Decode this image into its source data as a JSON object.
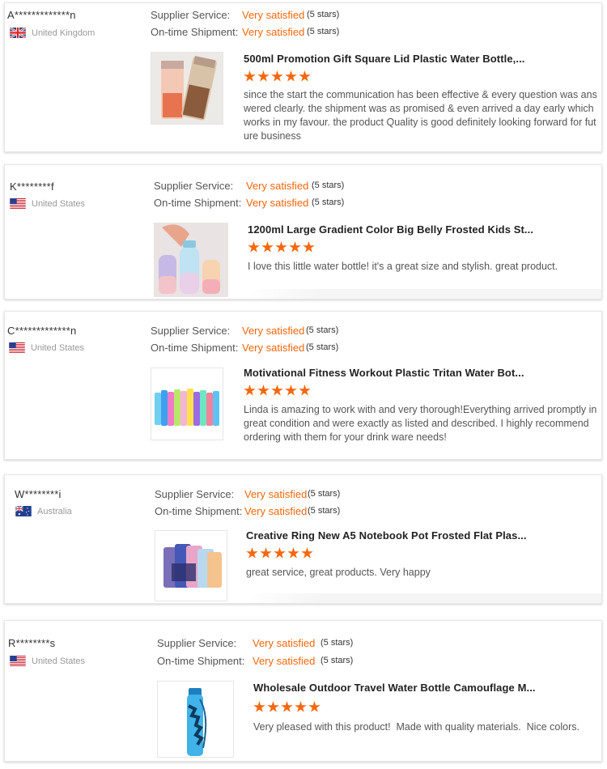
{
  "labels": {
    "supplier": "Supplier Service:",
    "shipment": "On-time Shipment:"
  },
  "reviews": [
    {
      "user": "A*************n",
      "country": "United Kingdom",
      "flag_icon": "uk-flag",
      "supplier_value": "Very satisfied",
      "supplier_stars": "(5 stars)",
      "shipment_value": "Very satisfied",
      "shipment_stars": "(5 stars)",
      "product_title": "500ml Promotion Gift Square Lid Plastic Water Bottle,...",
      "rating": 5,
      "text": "since the start the communication has been effective & every question was answered clearly. the shipment was as promised & even arrived a day early which works in my favour. the product Quality is good definitely looking forward for future business"
    },
    {
      "user": "K********f",
      "country": "United States",
      "flag_icon": "us-flag",
      "supplier_value": "Very satisfied",
      "supplier_stars": "(5 stars)",
      "shipment_value": "Very satisfied",
      "shipment_stars": "(5 stars)",
      "product_title": "1200ml Large Gradient Color Big Belly Frosted Kids St...",
      "rating": 5,
      "text": "I love this little water bottle! it's a great size and stylish. great product."
    },
    {
      "user": "C*************n",
      "country": "United States",
      "flag_icon": "us-flag",
      "supplier_value": "Very satisfied",
      "supplier_stars": "(5 stars)",
      "shipment_value": "Very satisfied",
      "shipment_stars": "(5 stars)",
      "product_title": "Motivational Fitness Workout Plastic Tritan Water Bot...",
      "rating": 5,
      "text": "Linda is amazing to work with and very thorough!Everything arrived promptly in great condition and were exactly as listed and described. I highly recommend ordering with them for your drink ware needs!"
    },
    {
      "user": "W********i",
      "country": "Australia",
      "flag_icon": "au-flag",
      "supplier_value": "Very satisfied",
      "supplier_stars": "(5 stars)",
      "shipment_value": "Very satisfied",
      "shipment_stars": "(5 stars)",
      "product_title": "Creative Ring New A5 Notebook Pot Frosted Flat Plas...",
      "rating": 5,
      "text": "great service, great products. Very happy"
    },
    {
      "user": "R********s",
      "country": "United States",
      "flag_icon": "us-flag",
      "supplier_value": "Very satisfied",
      "supplier_stars": "(5 stars)",
      "shipment_value": "Very satisfied",
      "shipment_stars": "(5 stars)",
      "product_title": "Wholesale Outdoor Travel Water Bottle Camouflage M...",
      "rating": 5,
      "text": "Very pleased with this product!  Made with quality materials.  Nice colors."
    }
  ]
}
